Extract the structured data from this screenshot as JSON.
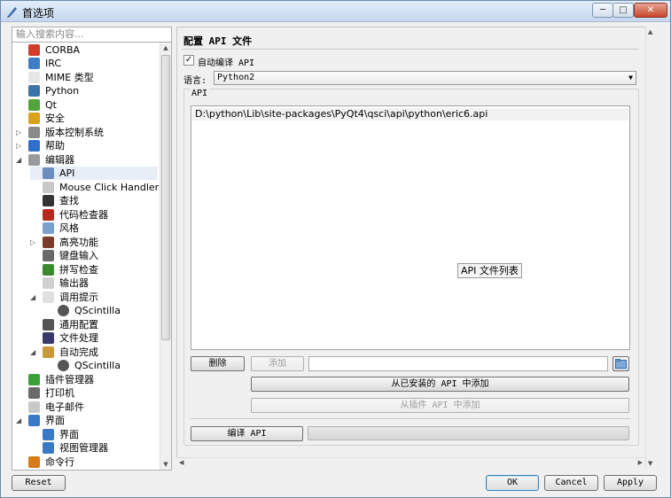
{
  "window": {
    "title": "首选项",
    "controls": {
      "minimize": "─",
      "maximize": "□",
      "close": "✕"
    }
  },
  "search": {
    "placeholder": "输入搜索内容..."
  },
  "tree": [
    {
      "label": "CORBA",
      "level": 1,
      "icon": "corba-icon",
      "color": "#d23c2c",
      "arrow": ""
    },
    {
      "label": "IRC",
      "level": 1,
      "icon": "irc-icon",
      "color": "#3d7ec4",
      "arrow": ""
    },
    {
      "label": "MIME 类型",
      "level": 1,
      "icon": "mime-icon",
      "color": "#e6e6e6",
      "arrow": ""
    },
    {
      "label": "Python",
      "level": 1,
      "icon": "python-icon",
      "color": "#3b73a8",
      "arrow": ""
    },
    {
      "label": "Qt",
      "level": 1,
      "icon": "qt-icon",
      "color": "#51a33a",
      "arrow": ""
    },
    {
      "label": "安全",
      "level": 1,
      "icon": "lock-icon",
      "color": "#d8a21c",
      "arrow": ""
    },
    {
      "label": "版本控制系统",
      "level": 1,
      "icon": "vcs-icon",
      "color": "#8a8a8a",
      "arrow": "▷"
    },
    {
      "label": "帮助",
      "level": 1,
      "icon": "help-icon",
      "color": "#2f6fcc",
      "arrow": "▷"
    },
    {
      "label": "编辑器",
      "level": 1,
      "icon": "editor-icon",
      "color": "#9a9a9a",
      "arrow": "◢"
    },
    {
      "label": "API",
      "level": 2,
      "icon": "api-icon",
      "color": "#6c8ebf",
      "arrow": "",
      "selected": true
    },
    {
      "label": "Mouse Click Handlers",
      "level": 2,
      "icon": "mouse-icon",
      "color": "#c8c8c8",
      "arrow": ""
    },
    {
      "label": "查找",
      "level": 2,
      "icon": "binoculars-icon",
      "color": "#333333",
      "arrow": ""
    },
    {
      "label": "代码检查器",
      "level": 2,
      "icon": "bug-icon",
      "color": "#b52a1c",
      "arrow": ""
    },
    {
      "label": "风格",
      "level": 2,
      "icon": "style-icon",
      "color": "#7aa0cc",
      "arrow": ""
    },
    {
      "label": "高亮功能",
      "level": 2,
      "icon": "highlight-icon",
      "color": "#7a3b28",
      "arrow": "▷"
    },
    {
      "label": "键盘输入",
      "level": 2,
      "icon": "keyboard-icon",
      "color": "#6a6a6a",
      "arrow": ""
    },
    {
      "label": "拼写检查",
      "level": 2,
      "icon": "spellcheck-icon",
      "color": "#3a8a2e",
      "arrow": ""
    },
    {
      "label": "输出器",
      "level": 2,
      "icon": "exporter-icon",
      "color": "#d0d0d0",
      "arrow": ""
    },
    {
      "label": "调用提示",
      "level": 2,
      "icon": "calltip-icon",
      "color": "#e0e0e0",
      "arrow": "◢"
    },
    {
      "label": "QScintilla",
      "level": 3,
      "icon": "qscintilla-icon",
      "color": "#555555",
      "arrow": ""
    },
    {
      "label": "通用配置",
      "level": 2,
      "icon": "general-icon",
      "color": "#555555",
      "arrow": ""
    },
    {
      "label": "文件处理",
      "level": 2,
      "icon": "save-icon",
      "color": "#3a3a6a",
      "arrow": ""
    },
    {
      "label": "自动完成",
      "level": 2,
      "icon": "autocomplete-icon",
      "color": "#c89a3a",
      "arrow": "◢"
    },
    {
      "label": "QScintilla",
      "level": 3,
      "icon": "qscintilla-icon",
      "color": "#555555",
      "arrow": ""
    },
    {
      "label": "插件管理器",
      "level": 1,
      "icon": "plugin-icon",
      "color": "#3aa03a",
      "arrow": ""
    },
    {
      "label": "打印机",
      "level": 1,
      "icon": "printer-icon",
      "color": "#6a6a6a",
      "arrow": ""
    },
    {
      "label": "电子邮件",
      "level": 1,
      "icon": "email-icon",
      "color": "#c8c8c8",
      "arrow": ""
    },
    {
      "label": "界面",
      "level": 1,
      "icon": "interface-icon",
      "color": "#3a78c8",
      "arrow": "◢"
    },
    {
      "label": "界面",
      "level": 2,
      "icon": "interface-icon",
      "color": "#3a78c8",
      "arrow": ""
    },
    {
      "label": "视图管理器",
      "level": 2,
      "icon": "viewmanager-icon",
      "color": "#3a78c8",
      "arrow": ""
    },
    {
      "label": "命令行",
      "level": 1,
      "icon": "shell-icon",
      "color": "#d87a1a",
      "arrow": ""
    }
  ],
  "page": {
    "header": "配置 API 文件",
    "auto_compile": {
      "label": "自动编译 API",
      "checked": "✓"
    },
    "language": {
      "label": "语言:",
      "value": "Python2",
      "dropdown": "▼"
    },
    "api_group": {
      "title": "API",
      "items": [
        "D:\\python\\Lib\\site-packages\\PyQt4\\qsci\\api\\python\\eric6.api"
      ],
      "tooltip": "API 文件列表"
    },
    "buttons": {
      "delete": "删除",
      "add": "添加",
      "add_installed": "从已安装的 API 中添加",
      "add_plugin": "从插件 API 中添加",
      "compile": "编译 API"
    }
  },
  "footer": {
    "reset": "Reset",
    "ok": "OK",
    "cancel": "Cancel",
    "apply": "Apply"
  }
}
